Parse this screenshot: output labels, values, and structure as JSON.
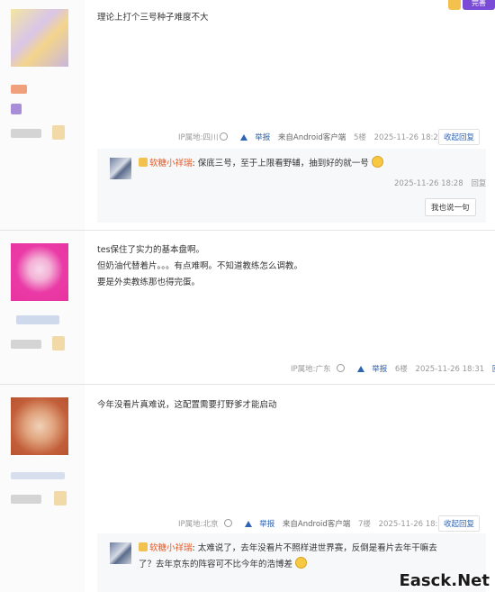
{
  "colors": {
    "link": "#2d64b3",
    "sub_name": "#e35b26",
    "badge": "#7a4bd6"
  },
  "top_badge": {
    "label": "完善"
  },
  "posts": [
    {
      "content": [
        "理论上打个三号种子难度不大"
      ],
      "ip": "IP属地:四川",
      "report": "举报",
      "client": "来自Android客户端",
      "floor": "5楼",
      "time": "2025-11-26 18:28",
      "reply_toggle": "收起回复",
      "subreplies": [
        {
          "name": "软糖小祥瑞",
          "text": "保底三号，至于上限看野辅，抽到好的就一号",
          "time": "2025-11-26 18:28",
          "reply": "回复"
        }
      ],
      "say_one": "我也说一句"
    },
    {
      "content": [
        "tes保住了实力的基本盘啊。",
        "但奶油代替着片。。。有点难啊。不知道教练怎么调教。",
        "要是外卖教练那也得完蛋。"
      ],
      "ip": "IP属地:广东",
      "report": "举报",
      "floor": "6楼",
      "time": "2025-11-26 18:31",
      "reply_toggle": "回复"
    },
    {
      "content": [
        "今年没看片真难说，这配置需要打野爹才能启动"
      ],
      "ip": "IP属地:北京",
      "report": "举报",
      "client": "来自Android客户端",
      "floor": "7楼",
      "time": "2025-11-26 18:31",
      "reply_toggle": "收起回复",
      "subreplies": [
        {
          "name": "软糖小祥瑞",
          "text_line1": "太难说了，去年没看片不照样进世界赛，反倒是看片去年干嘛去",
          "text_line2": "了？去年京东的阵容可不比今年的浩博差"
        }
      ]
    }
  ],
  "watermark": "Easck.Net"
}
